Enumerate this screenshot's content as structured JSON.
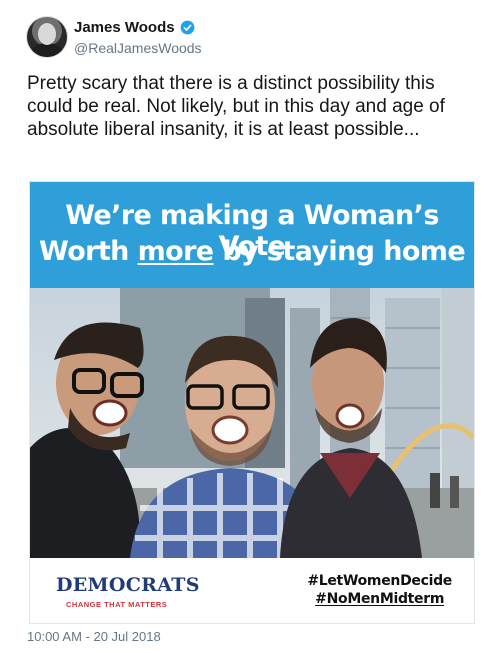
{
  "author": {
    "name": "James Woods",
    "handle": "@RealJamesWoods",
    "verified_icon": "verified-badge-icon"
  },
  "tweet": {
    "text": "Pretty scary that there is a distinct possibility this could be real. Not likely, but in this day and age of absolute liberal insanity, it is at least possible...",
    "timestamp": "10:00 AM - 20 Jul 2018"
  },
  "card": {
    "banner_line1": "We’re making a Woman’s Vote",
    "banner_line2_prefix": "Worth ",
    "banner_line2_underlined": "more",
    "banner_line2_suffix": " by staying home",
    "org_name": "DEMOCRATS",
    "org_tagline": "CHANGE THAT MATTERS",
    "hashtag1": "#LetWomenDecide",
    "hashtag2": "#NoMenMidterm"
  },
  "colors": {
    "banner": "#2e9fd8",
    "verified": "#1da1f2",
    "democrats_blue": "#1f3b78",
    "tagline_red": "#d4333c",
    "secondary_text": "#657786"
  }
}
